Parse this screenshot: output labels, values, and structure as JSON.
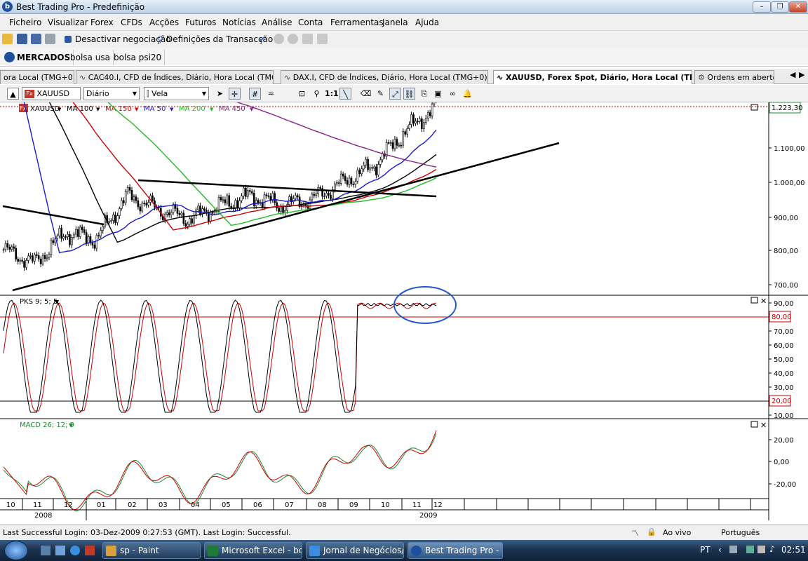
{
  "window": {
    "title": "Best Trading Pro - Predefinição",
    "logo": "b"
  },
  "menu": [
    "Ficheiro",
    "Visualizar",
    "Forex",
    "CFDs",
    "Acções",
    "Futuros",
    "Notícias",
    "Análise",
    "Conta",
    "Ferramentas",
    "Janela",
    "Ajuda"
  ],
  "toolbar": {
    "deactivate": "Desactivar negociação",
    "settings": "Definições da Transacção"
  },
  "markets": {
    "main": "MERCADOS",
    "tabs": [
      "bolsa usa",
      "bolsa psi20"
    ]
  },
  "chart_tabs": [
    {
      "label": "ora Local (TMG+0)",
      "active": false
    },
    {
      "label": "CAC40.I, CFD de Índices, Diário, Hora Local (TMG+0)",
      "active": false
    },
    {
      "label": "DAX.I, CFD de Índices, Diário, Hora Local (TMG+0)",
      "active": false
    },
    {
      "label": "XAUUSD, Forex Spot, Diário, Hora Local (TMG+0)",
      "active": true
    },
    {
      "label": "Ordens em aberto",
      "active": false
    }
  ],
  "chart_toolbar": {
    "symbol": "XAUUSD",
    "period": "Diário",
    "style": "Vela"
  },
  "price_panel": {
    "legend": [
      {
        "label": "XAUUSD",
        "color": "#000000"
      },
      {
        "label": "MA 100",
        "color": "#000000"
      },
      {
        "label": "MA 150",
        "color": "#cc0000"
      },
      {
        "label": "MA 50",
        "color": "#1a1acc"
      },
      {
        "label": "MA 200",
        "color": "#22bb22"
      },
      {
        "label": "MA 450",
        "color": "#882288"
      }
    ],
    "ticks": [
      "1.100,00",
      "1.000,00",
      "900,00",
      "800,00",
      "700,00"
    ],
    "last_price": "1.223,30"
  },
  "pks_panel": {
    "label": "PKS 9; 5; 5",
    "ticks": [
      "90,00",
      "70,00",
      "60,00",
      "50,00",
      "40,00",
      "30,00",
      "10,00"
    ],
    "upper_level": "80,00",
    "lower_level": "20,00"
  },
  "macd_panel": {
    "label": "MACD 26; 12; 9",
    "ticks": [
      "20,00",
      "0,00",
      "-20,00"
    ]
  },
  "time_axis": {
    "months": [
      "10",
      "11",
      "12",
      "01",
      "02",
      "03",
      "04",
      "05",
      "06",
      "07",
      "08",
      "09",
      "10",
      "11",
      "12"
    ],
    "years": [
      "2008",
      "2009"
    ]
  },
  "status": {
    "login": "Last Successful Login: 03-Dez-2009 0:27:53 (GMT). Last Login: Successful.",
    "live": "Ao vivo",
    "language": "Português"
  },
  "taskbar": {
    "tasks": [
      "sp - Paint",
      "Microsoft Excel - bo...",
      "Jornal de Negócios/...",
      "Best Trading Pro - P..."
    ],
    "lang": "PT",
    "clock": "02:51"
  },
  "chart_data": {
    "type": "line",
    "title": "XAUUSD",
    "x_range": [
      "2008-10",
      "2009-12"
    ],
    "price_range": [
      650,
      1240
    ],
    "price_close_approx": [
      {
        "x": "2008-10",
        "y": 800
      },
      {
        "x": "2008-11",
        "y": 760
      },
      {
        "x": "2008-12",
        "y": 850
      },
      {
        "x": "2009-01",
        "y": 830
      },
      {
        "x": "2009-02",
        "y": 960
      },
      {
        "x": "2009-03",
        "y": 920
      },
      {
        "x": "2009-04",
        "y": 890
      },
      {
        "x": "2009-05",
        "y": 930
      },
      {
        "x": "2009-06",
        "y": 960
      },
      {
        "x": "2009-07",
        "y": 930
      },
      {
        "x": "2009-08",
        "y": 950
      },
      {
        "x": "2009-09",
        "y": 1000
      },
      {
        "x": "2009-10",
        "y": 1050
      },
      {
        "x": "2009-11",
        "y": 1150
      },
      {
        "x": "2009-12",
        "y": 1223.3
      }
    ],
    "pks_levels": [
      80,
      20
    ],
    "pks_range": [
      0,
      100
    ],
    "macd_range": [
      -30,
      35
    ]
  },
  "colors": {
    "price": "#000000",
    "ma150": "#cc0000",
    "ma50": "#1a1acc",
    "ma200": "#22bb22",
    "ma450": "#882288",
    "ma100": "#000000",
    "pks_k": "#000000",
    "pks_d": "#cc0000",
    "macd": "#cc0000",
    "signal": "#228833",
    "annotation": "#2255cc",
    "trend": "#000000"
  }
}
